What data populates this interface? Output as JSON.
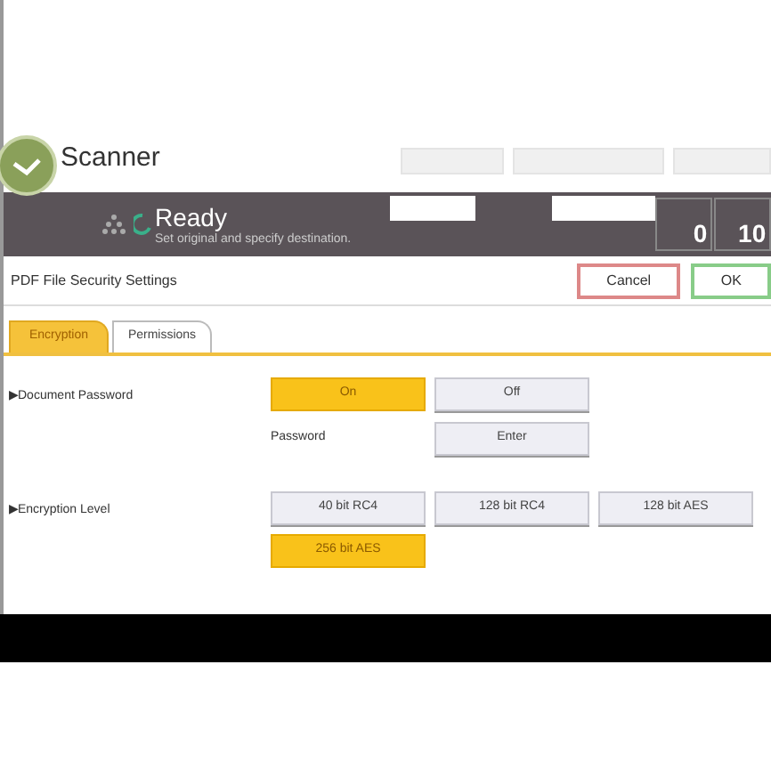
{
  "app": {
    "title": "Scanner"
  },
  "status": {
    "title": "Ready",
    "message": "Set original and specify destination."
  },
  "counters": [
    {
      "value": "0"
    },
    {
      "value": "10"
    }
  ],
  "dialog": {
    "title": "PDF File Security Settings",
    "buttons": [
      {
        "label": "Cancel",
        "kind": "cancel"
      },
      {
        "label": "OK",
        "kind": "ok"
      }
    ]
  },
  "tabs": [
    {
      "label": "Encryption",
      "selected": true
    },
    {
      "label": "Permissions",
      "selected": false
    }
  ],
  "sections": [
    {
      "label": "▶Document Password",
      "options": [
        {
          "label": "On",
          "selected": true
        },
        {
          "label": "Off",
          "selected": false
        }
      ],
      "sub": {
        "label": "Password",
        "button": "Enter"
      }
    },
    {
      "label": "▶Encryption Level",
      "options": [
        {
          "label": "40 bit RC4",
          "selected": false
        },
        {
          "label": "128 bit RC4",
          "selected": false
        },
        {
          "label": "128 bit AES",
          "selected": false
        },
        {
          "label": "256 bit AES",
          "selected": true
        }
      ]
    }
  ]
}
